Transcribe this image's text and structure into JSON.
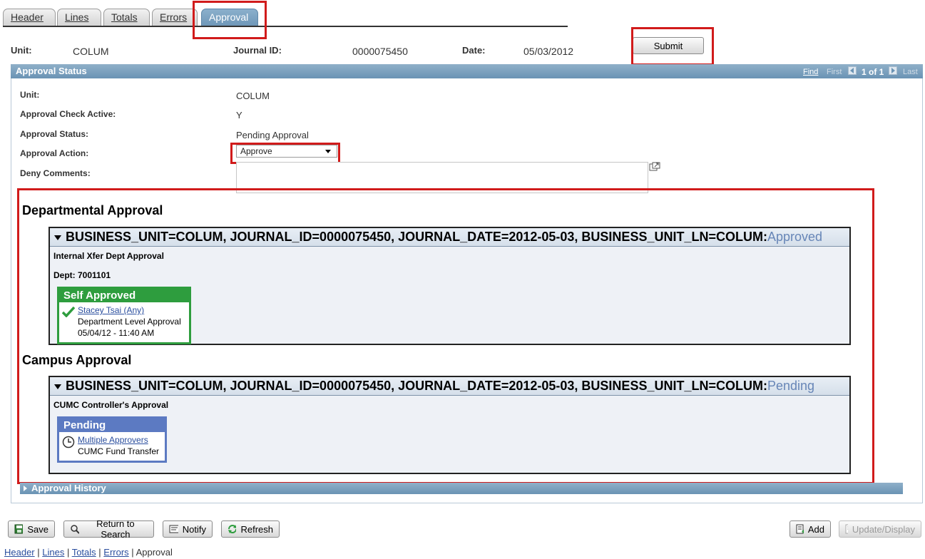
{
  "tabs": [
    {
      "label": "Header"
    },
    {
      "label": "Lines"
    },
    {
      "label": "Totals"
    },
    {
      "label": "Errors"
    },
    {
      "label": "Approval",
      "active": true
    }
  ],
  "header_fields": {
    "unit_label": "Unit:",
    "unit_value": "COLUM",
    "journal_label": "Journal ID:",
    "journal_value": "0000075450",
    "date_label": "Date:",
    "date_value": "05/03/2012"
  },
  "submit_label": "Submit",
  "approval_status_section": {
    "title": "Approval Status",
    "nav": {
      "find": "Find",
      "first": "First",
      "count": "1 of 1",
      "last": "Last"
    },
    "fields": {
      "unit_label": "Unit:",
      "unit_value": "COLUM",
      "check_label": "Approval Check Active:",
      "check_value": "Y",
      "status_label": "Approval Status:",
      "status_value": "Pending Approval",
      "action_label": "Approval Action:",
      "action_value": "Approve",
      "deny_label": "Deny Comments:"
    }
  },
  "departmental": {
    "title": "Departmental Approval",
    "header_text": "BUSINESS_UNIT=COLUM, JOURNAL_ID=0000075450, JOURNAL_DATE=2012-05-03, BUSINESS_UNIT_LN=COLUM:",
    "header_status": "Approved",
    "stage_name": "Internal Xfer Dept Approval",
    "dept": "Dept: 7001101",
    "card": {
      "status": "Self Approved",
      "approver": "Stacey Tsai (Any)",
      "role": "Department Level Approval",
      "timestamp": "05/04/12 - 11:40 AM",
      "color": "#2e9d3e"
    }
  },
  "campus": {
    "title": "Campus Approval",
    "header_text": "BUSINESS_UNIT=COLUM, JOURNAL_ID=0000075450, JOURNAL_DATE=2012-05-03, BUSINESS_UNIT_LN=COLUM:",
    "header_status": "Pending",
    "stage_name": "CUMC Controller's Approval",
    "card": {
      "status": "Pending",
      "approver": "Multiple Approvers",
      "role": "CUMC Fund Transfer",
      "color": "#5c7ac2"
    }
  },
  "history_title": "Approval History",
  "bottom_buttons": {
    "save": "Save",
    "return": "Return to Search",
    "notify": "Notify",
    "refresh": "Refresh",
    "add": "Add",
    "update": "Update/Display"
  },
  "bottom_links": [
    "Header",
    "Lines",
    "Totals",
    "Errors",
    "Approval"
  ],
  "highlight_color": "#d11b1b"
}
